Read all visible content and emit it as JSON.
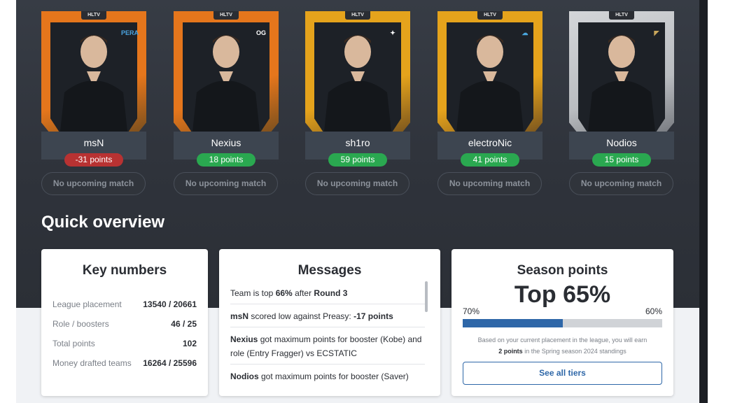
{
  "players": [
    {
      "name": "msN",
      "points": "-31 points",
      "status": "No upcoming match",
      "frame_color": "#e5761c",
      "team": "pera-logo-icon",
      "team_text": "PERA",
      "team_color": "#4aa3df"
    },
    {
      "name": "Nexius",
      "points": "18 points",
      "status": "No upcoming match",
      "frame_color": "#e5761c",
      "team": "og-logo-icon",
      "team_text": "OG",
      "team_color": "#ffffff"
    },
    {
      "name": "sh1ro",
      "points": "59 points",
      "status": "No upcoming match",
      "frame_color": "#e5a31c",
      "team": "spirit-logo-icon",
      "team_text": "✦",
      "team_color": "#ffffff"
    },
    {
      "name": "electroNic",
      "points": "41 points",
      "status": "No upcoming match",
      "frame_color": "#e5a31c",
      "team": "cloud9-logo-icon",
      "team_text": "☁",
      "team_color": "#4aa8e0"
    },
    {
      "name": "Nodios",
      "points": "15 points",
      "status": "No upcoming match",
      "frame_color": "#b9bcc0",
      "team": "ecstatic-logo-icon",
      "team_text": "◤",
      "team_color": "#c9a75c"
    }
  ],
  "hltv_badge": "HLTV",
  "quick_overview": "Quick overview",
  "key_numbers": {
    "title": "Key numbers",
    "rows": [
      {
        "label": "League placement",
        "value": "13540 / 20661"
      },
      {
        "label": "Role / boosters",
        "value": "46 / 25"
      },
      {
        "label": "Total points",
        "value": "102"
      },
      {
        "label": "Money drafted teams",
        "value": "16264 / 25596"
      }
    ]
  },
  "messages": {
    "title": "Messages",
    "items": [
      {
        "a": "Team is top ",
        "b": "66%",
        "c": " after ",
        "d": "Round 3",
        "e": ""
      },
      {
        "a": "",
        "b": "msN",
        "c": " scored low against Preasy: ",
        "d": "-17 points",
        "e": ""
      },
      {
        "a": "",
        "b": "Nexius",
        "c": " got maximum points for booster (Kobe) and role (Entry Fragger) vs ECSTATIC",
        "d": "",
        "e": ""
      },
      {
        "a": "",
        "b": "Nodios",
        "c": " got maximum points for booster (Saver)",
        "d": "",
        "e": ""
      }
    ]
  },
  "season": {
    "title": "Season points",
    "top": "Top 65%",
    "left_label": "70%",
    "right_label": "60%",
    "progress": 0.5,
    "note_1": "Based on your current placement in the league, you will earn",
    "note_points": "2 points",
    "note_2": " in the Spring season 2024 standings",
    "button": "See all tiers"
  },
  "colors": {
    "negative": "#b83232",
    "positive": "#2aa850",
    "accent": "#2e67a8"
  }
}
